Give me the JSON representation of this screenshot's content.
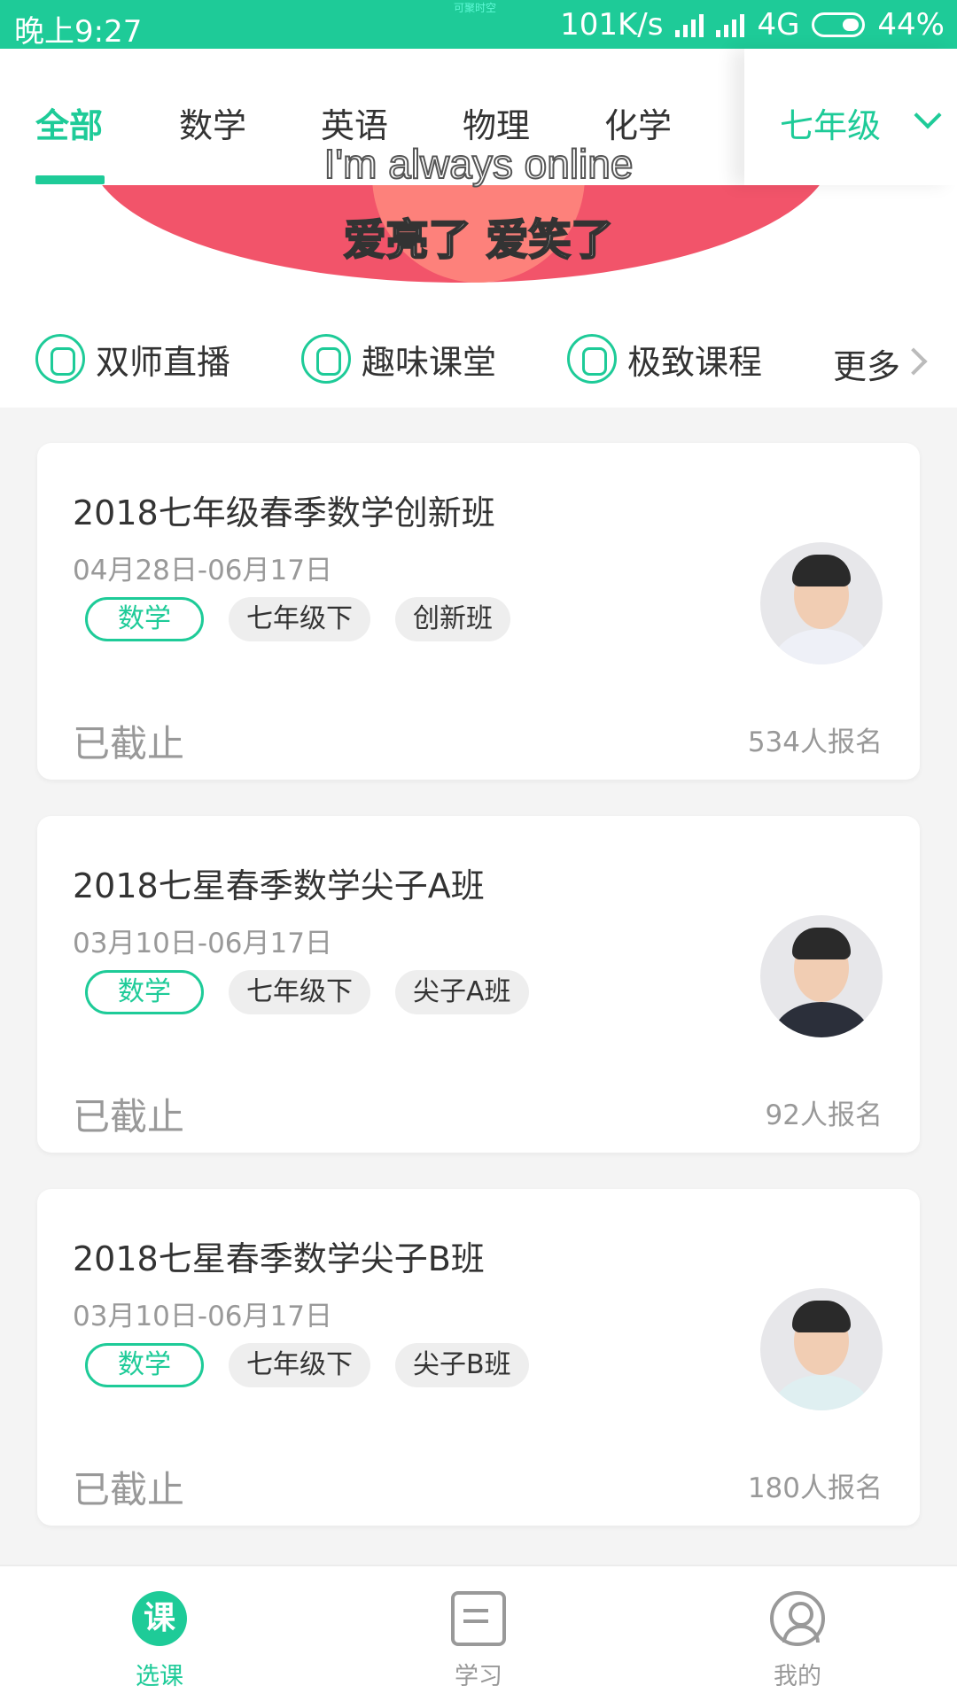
{
  "status_bar": {
    "time": "晚上9:27",
    "tiny_text": "可聚时空",
    "network_speed": "101K/s",
    "network_type": "4G",
    "battery": "44%"
  },
  "top_tabs": {
    "items": [
      "全部",
      "数学",
      "英语",
      "物理",
      "化学"
    ],
    "active_index": 0,
    "grade_label": "七年级",
    "accent_color": "#1ecb98"
  },
  "overlay_text": "I'm always online",
  "banner": {
    "slogan": "爱亮了 爱笑了"
  },
  "categories": [
    {
      "label": "双师直播",
      "icon": "dual-teacher-icon"
    },
    {
      "label": "趣味课堂",
      "icon": "thumbs-up-icon"
    },
    {
      "label": "极致课程",
      "icon": "award-icon"
    }
  ],
  "more_label": "更多",
  "courses": [
    {
      "title": "2018七年级春季数学创新班",
      "date": "04月28日-06月17日",
      "tags": [
        "数学",
        "七年级下",
        "创新班"
      ],
      "status": "已截止",
      "enrolled": "534人报名"
    },
    {
      "title": "2018七星春季数学尖子A班",
      "date": "03月10日-06月17日",
      "tags": [
        "数学",
        "七年级下",
        "尖子A班"
      ],
      "status": "已截止",
      "enrolled": "92人报名"
    },
    {
      "title": "2018七星春季数学尖子B班",
      "date": "03月10日-06月17日",
      "tags": [
        "数学",
        "七年级下",
        "尖子B班"
      ],
      "status": "已截止",
      "enrolled": "180人报名"
    }
  ],
  "bottom_nav": {
    "items": [
      {
        "label": "选课",
        "icon_text": "课",
        "active": true
      },
      {
        "label": "学习",
        "active": false
      },
      {
        "label": "我的",
        "active": false
      }
    ]
  }
}
